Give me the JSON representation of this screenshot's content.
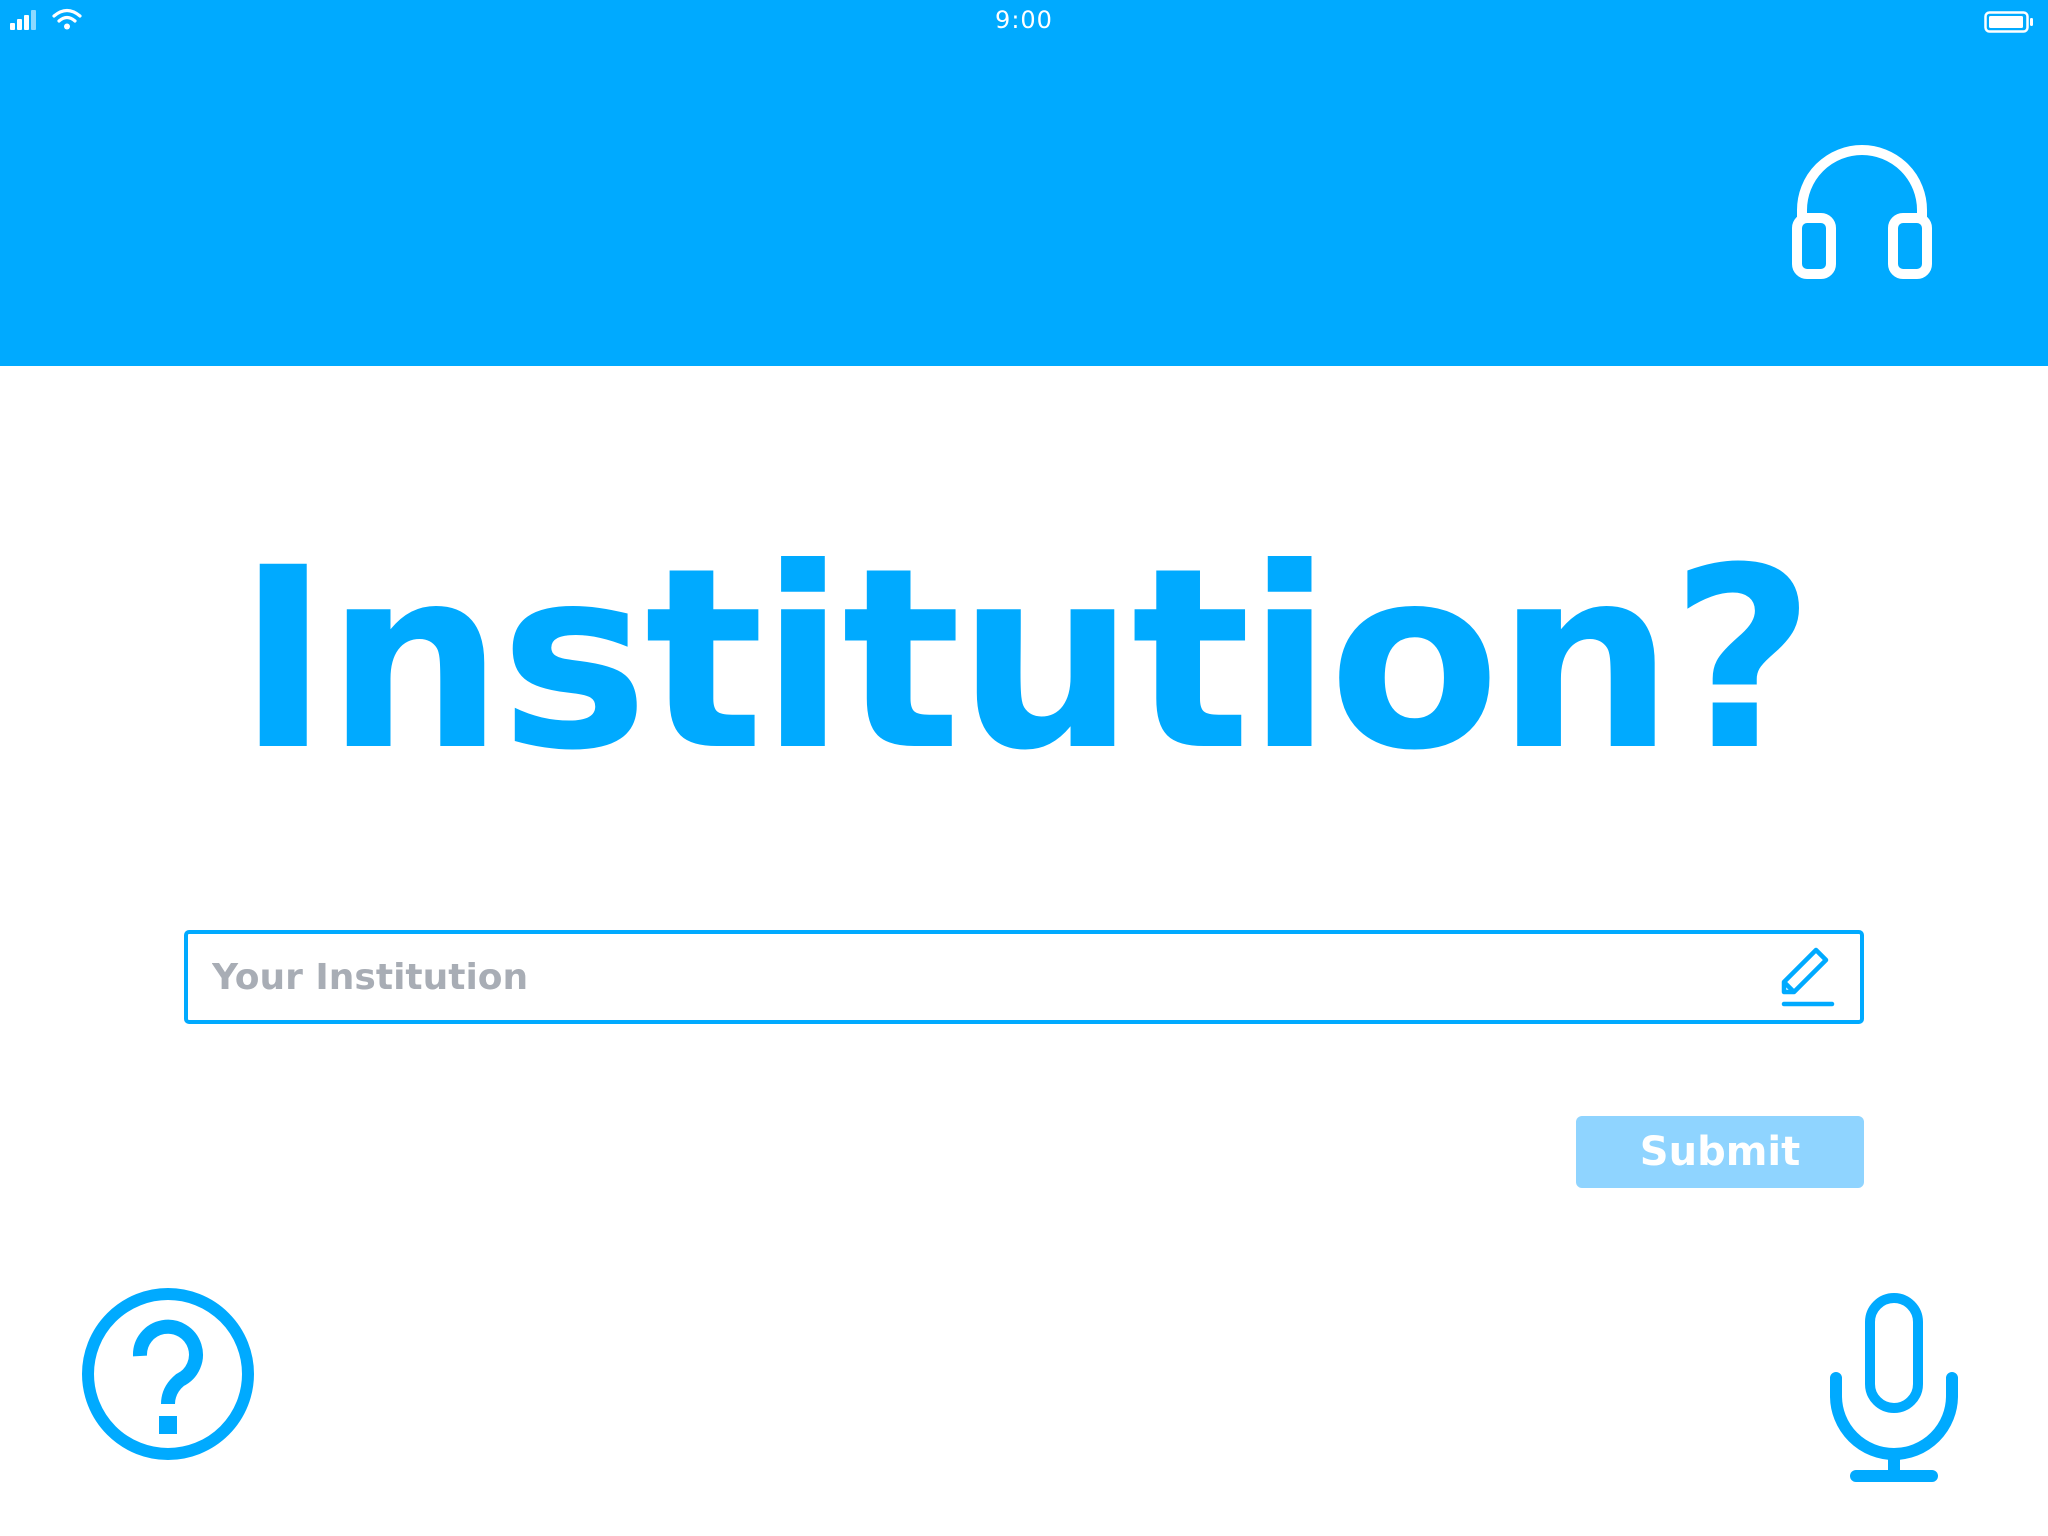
{
  "status_bar": {
    "time": "9:00"
  },
  "header": {
    "support_icon": "headphones-icon"
  },
  "main": {
    "question": "Institution?",
    "input": {
      "placeholder": "Your Institution",
      "value": "",
      "icon": "pencil-icon"
    },
    "submit_label": "Submit"
  },
  "footer": {
    "help_icon": "help-icon",
    "voice_icon": "microphone-icon"
  },
  "colors": {
    "accent": "#00aaff",
    "submit_disabled": "#8fd4ff",
    "placeholder": "#a8adb5",
    "background": "#ffffff"
  }
}
